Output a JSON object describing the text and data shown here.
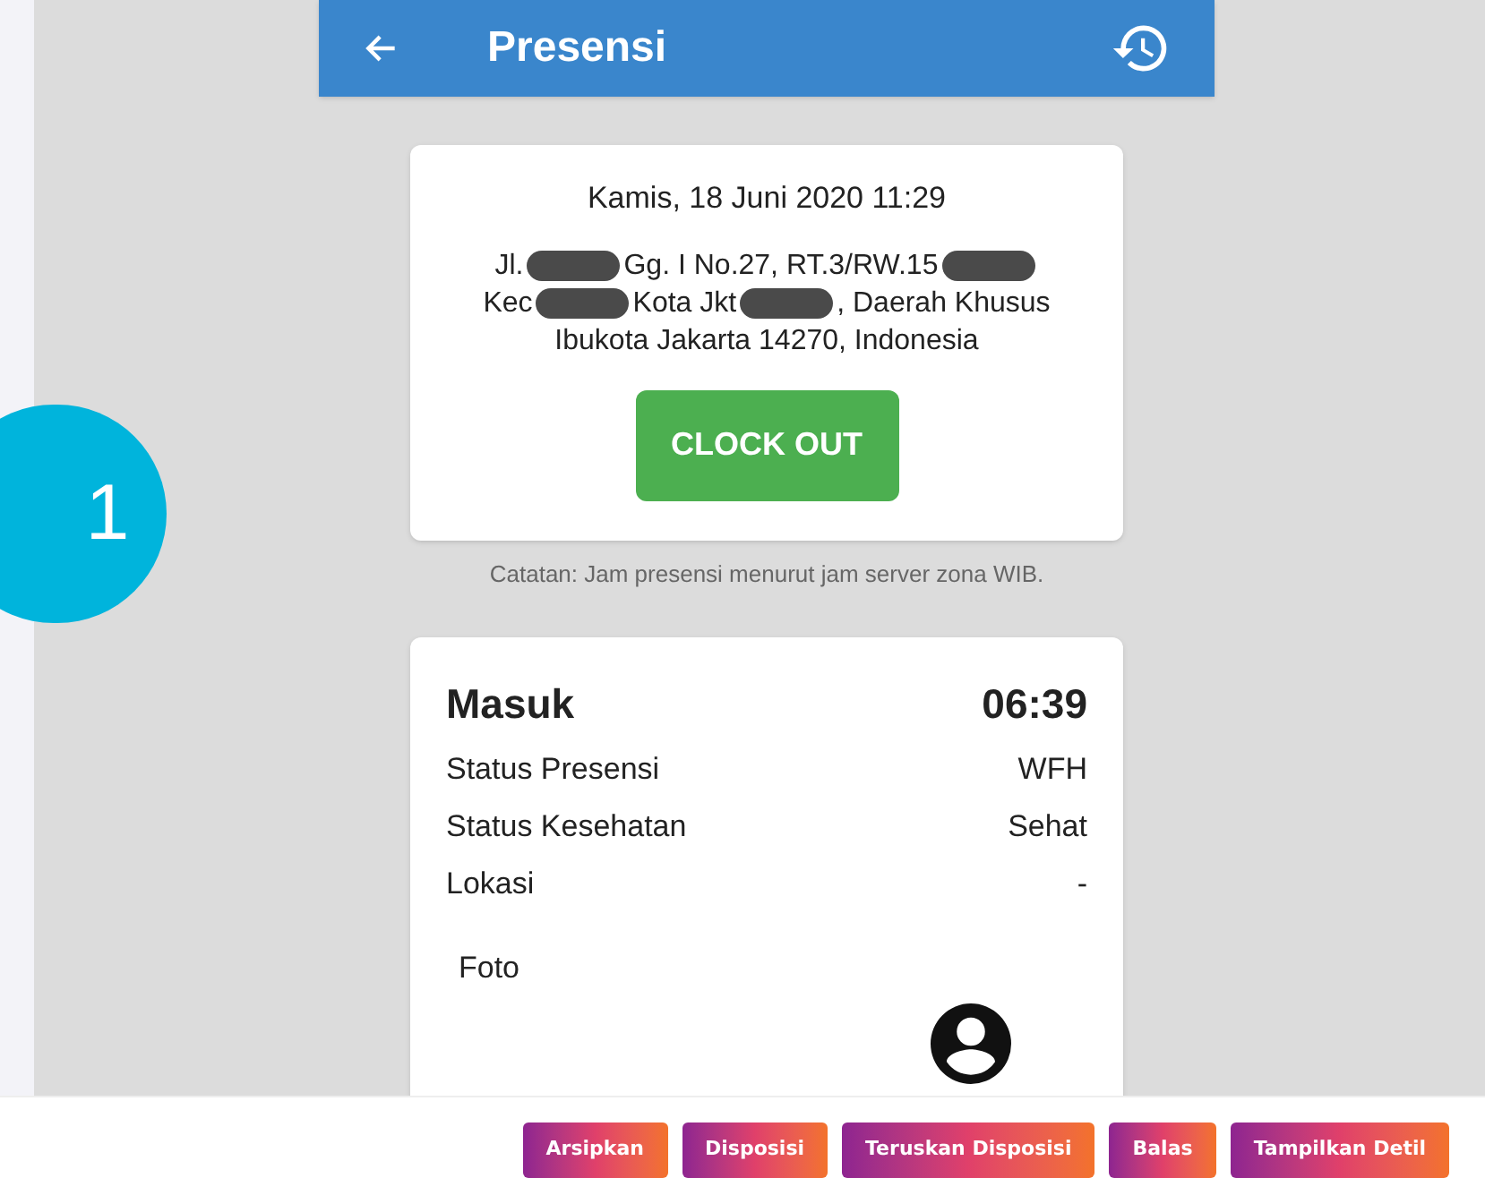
{
  "app_bar": {
    "title": "Presensi"
  },
  "clock_card": {
    "datetime": "Kamis, 18 Juni 2020  11:29",
    "address_lines": [
      [
        {
          "kind": "text",
          "text": "Jl."
        },
        {
          "kind": "redacted"
        },
        {
          "kind": "text",
          "text": "Gg. I No.27, RT.3/RW.15"
        },
        {
          "kind": "redacted"
        }
      ],
      [
        {
          "kind": "text",
          "text": "Kec"
        },
        {
          "kind": "redacted"
        },
        {
          "kind": "text",
          "text": "Kota Jkt"
        },
        {
          "kind": "redacted"
        },
        {
          "kind": "text",
          "text": ", Daerah Khusus"
        }
      ],
      [
        {
          "kind": "text",
          "text": "Ibukota Jakarta 14270, Indonesia"
        }
      ]
    ],
    "button": "CLOCK OUT"
  },
  "note": "Catatan: Jam presensi menurut jam server zona WIB.",
  "attendance_card": {
    "title": "Masuk",
    "time": "06:39",
    "rows": [
      {
        "label": "Status Presensi",
        "value": "WFH"
      },
      {
        "label": "Status Kesehatan",
        "value": "Sehat"
      },
      {
        "label": "Lokasi",
        "value": "-"
      }
    ],
    "photo_label": "Foto"
  },
  "step_badge": "1",
  "actions": [
    "Arsipkan",
    "Disposisi",
    "Teruskan Disposisi",
    "Balas",
    "Tampilkan Detil"
  ]
}
